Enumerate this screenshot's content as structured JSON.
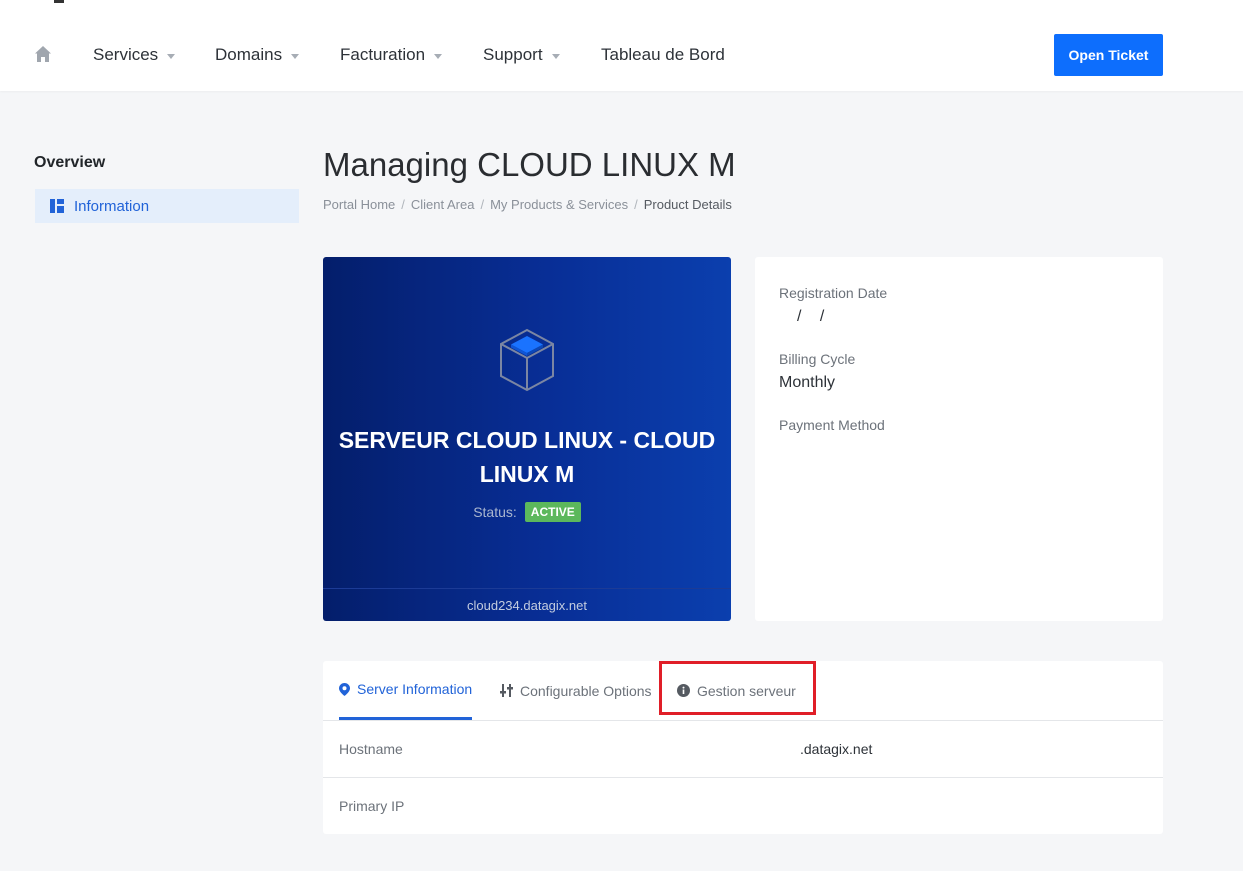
{
  "header": {
    "nav": [
      {
        "label": "Services",
        "has_dropdown": true
      },
      {
        "label": "Domains",
        "has_dropdown": true
      },
      {
        "label": "Facturation",
        "has_dropdown": true
      },
      {
        "label": "Support",
        "has_dropdown": true
      },
      {
        "label": "Tableau de Bord",
        "has_dropdown": false
      }
    ],
    "open_ticket_label": "Open Ticket",
    "accent_color": "#0d6efd"
  },
  "sidebar": {
    "title": "Overview",
    "items": [
      {
        "label": "Information",
        "icon": "dashboard-icon",
        "active": true
      }
    ]
  },
  "main": {
    "title": "Managing CLOUD LINUX M",
    "breadcrumb": [
      "Portal Home",
      "Client Area",
      "My Products & Services",
      "Product Details"
    ]
  },
  "product": {
    "icon": "cube-icon",
    "name": "SERVEUR CLOUD LINUX - CLOUD LINUX M",
    "status_label": "Status:",
    "status": "ACTIVE",
    "status_color": "#5cb85c",
    "domain": "cloud234.datagix.net"
  },
  "details": {
    "registration_date_label": "Registration Date",
    "registration_date": "/ /",
    "billing_cycle_label": "Billing Cycle",
    "billing_cycle": "Monthly",
    "payment_method_label": "Payment Method"
  },
  "tabs": [
    {
      "label": "Server Information",
      "icon": "location-pin-icon",
      "active": true
    },
    {
      "label": "Configurable Options",
      "icon": "sliders-icon",
      "active": false
    },
    {
      "label": "Gestion serveur",
      "icon": "info-circle-icon",
      "active": false
    }
  ],
  "server_info": [
    {
      "label": "Hostname",
      "value": ".datagix.net"
    },
    {
      "label": "Primary IP",
      "value": ""
    }
  ]
}
